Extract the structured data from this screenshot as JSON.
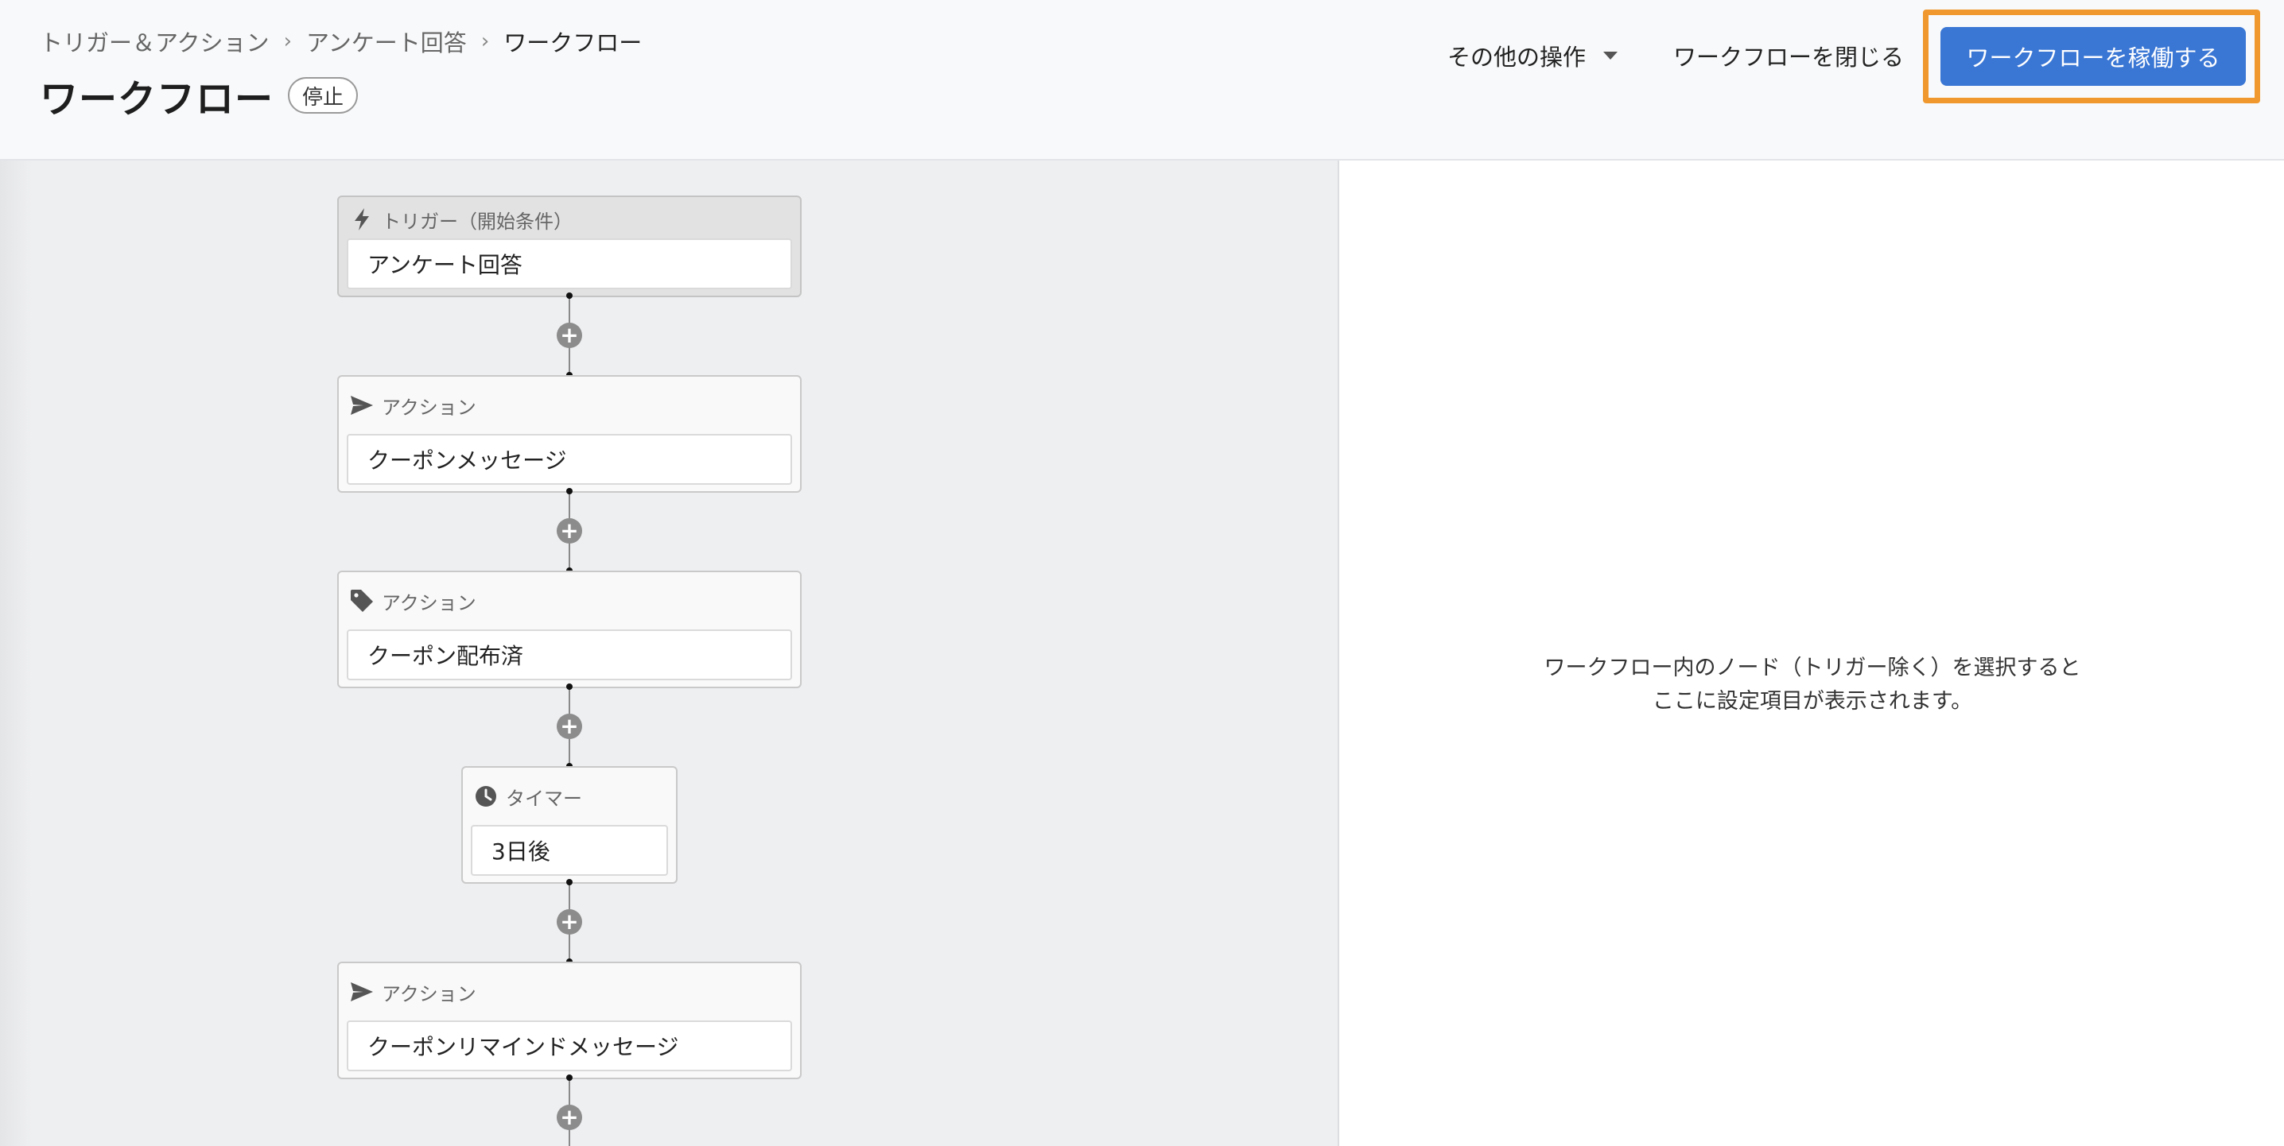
{
  "breadcrumb": {
    "items": [
      "トリガー＆アクション",
      "アンケート回答",
      "ワークフロー"
    ],
    "separator": "›"
  },
  "page": {
    "title": "ワークフロー",
    "status": "停止"
  },
  "header_actions": {
    "more_label": "その他の操作",
    "close_label": "ワークフローを閉じる",
    "activate_label": "ワークフローを稼働する"
  },
  "colors": {
    "primary": "#3a76d4",
    "highlight": "#f0982e",
    "canvas": "#eeeff1"
  },
  "workflow": {
    "add_label": "+",
    "nodes": [
      {
        "kind": "trigger",
        "icon": "bolt-icon",
        "label": "トリガー（開始条件）",
        "value": "アンケート回答"
      },
      {
        "kind": "action",
        "icon": "send-icon",
        "label": "アクション",
        "value": "クーポンメッセージ"
      },
      {
        "kind": "action",
        "icon": "tag-icon",
        "label": "アクション",
        "value": "クーポン配布済"
      },
      {
        "kind": "timer",
        "icon": "clock-icon",
        "label": "タイマー",
        "value": "3日後"
      },
      {
        "kind": "action",
        "icon": "send-icon",
        "label": "アクション",
        "value": "クーポンリマインドメッセージ"
      }
    ]
  },
  "side_panel": {
    "message_line1": "ワークフロー内のノード（トリガー除く）を選択すると",
    "message_line2": "ここに設定項目が表示されます。"
  }
}
